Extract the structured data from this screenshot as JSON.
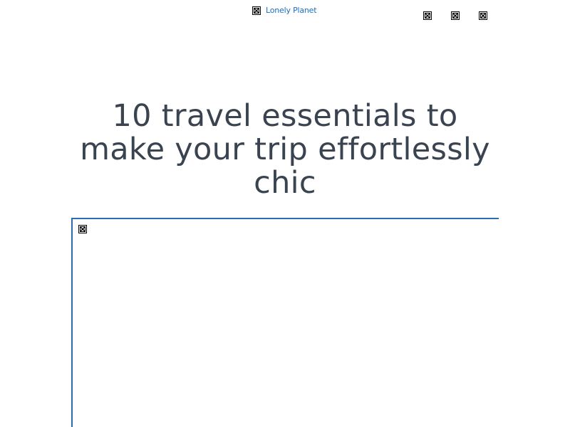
{
  "header": {
    "logo": {
      "text": "Lonely Planet",
      "icon": "broken-image-icon"
    },
    "icons": [
      "broken-image-icon",
      "broken-image-icon",
      "broken-image-icon"
    ]
  },
  "article": {
    "title": "10 travel essentials to make your trip effortlessly chic",
    "hero_image_icon": "broken-image-icon"
  },
  "colors": {
    "link": "#1a6fc4",
    "title": "#3a4350",
    "frame_border": "#2a6db5"
  }
}
